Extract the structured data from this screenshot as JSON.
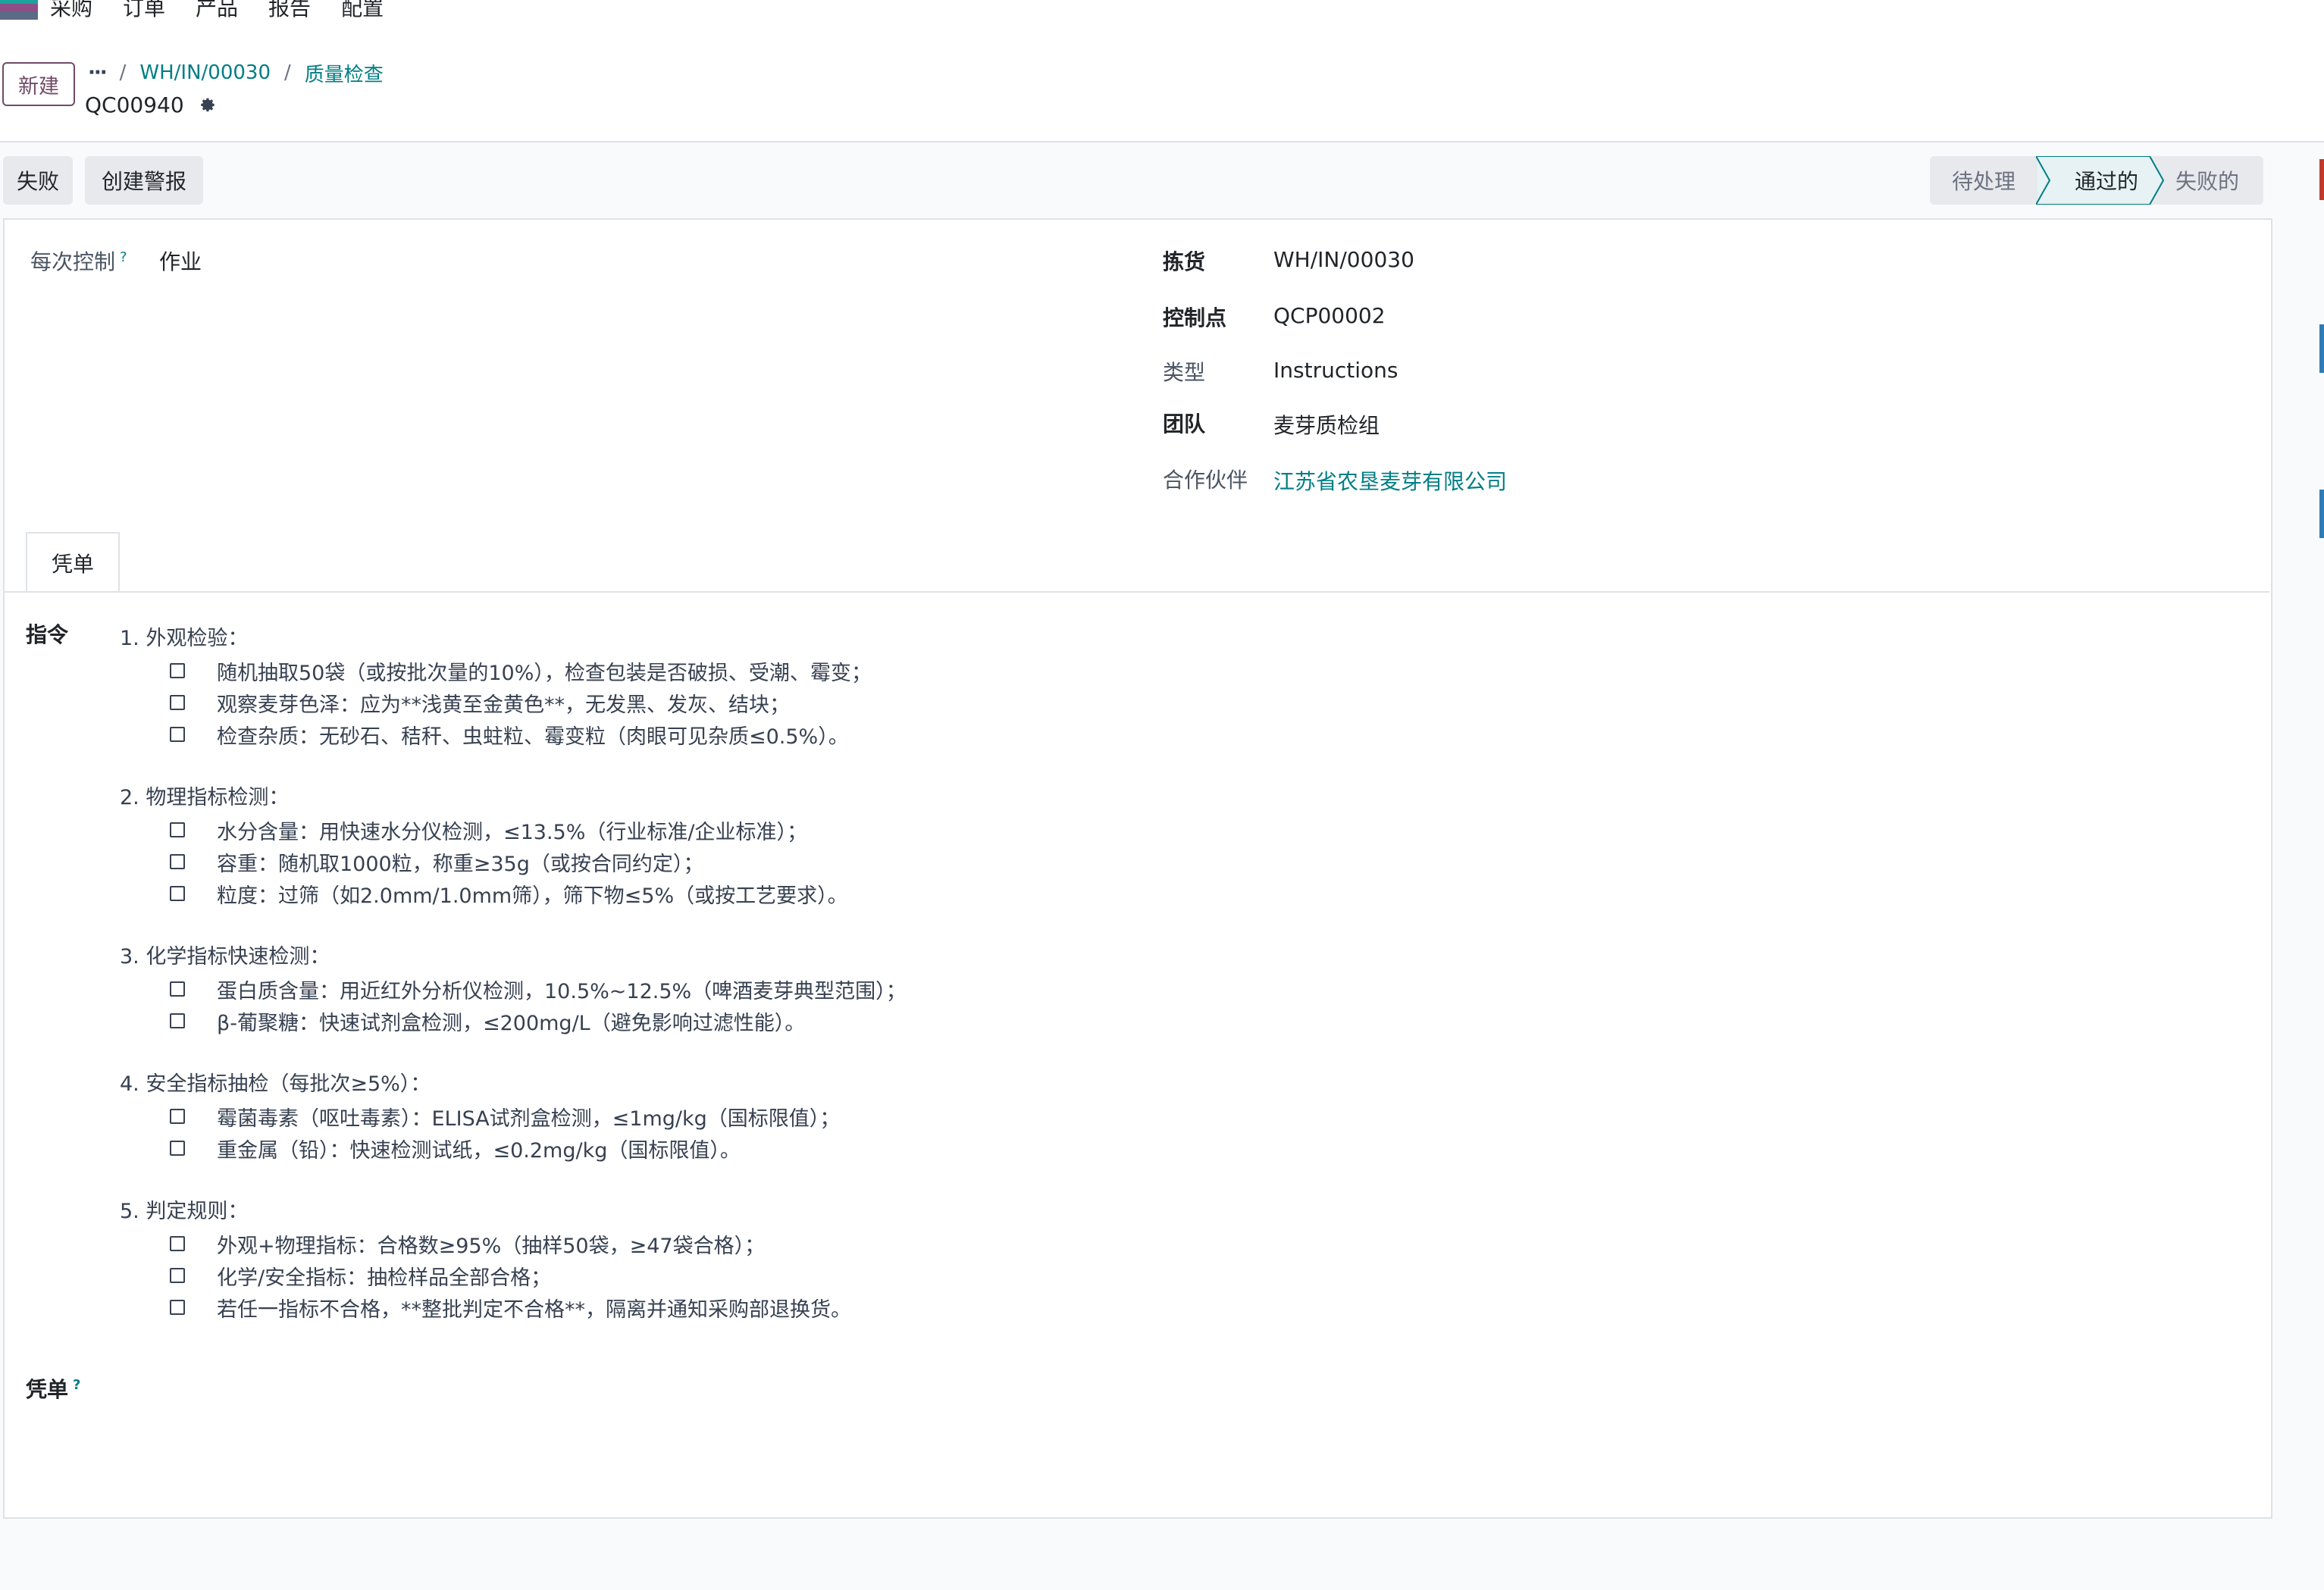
{
  "topnav": {
    "app_name": "采购",
    "menu": [
      "订单",
      "产品",
      "报告",
      "配置"
    ]
  },
  "control_panel": {
    "new_button": "新建",
    "breadcrumb": {
      "dots": "···",
      "sep": "/",
      "items": [
        "WH/IN/00030",
        "质量检查"
      ]
    },
    "record_name": "QC00940"
  },
  "actions": {
    "fail_button": "失败",
    "create_alert_button": "创建警报"
  },
  "statusbar": {
    "steps": [
      "待处理",
      "通过的",
      "失败的"
    ],
    "current": "通过的"
  },
  "form": {
    "left": {
      "control_per_label": "每次控制",
      "help": "?",
      "control_per_value": "作业"
    },
    "right": [
      {
        "label": "拣货",
        "value": "WH/IN/00030",
        "bold": true,
        "link": false
      },
      {
        "label": "控制点",
        "value": "QCP00002",
        "bold": true,
        "link": false
      },
      {
        "label": "类型",
        "value": "Instructions",
        "bold": false,
        "link": false
      },
      {
        "label": "团队",
        "value": "麦芽质检组",
        "bold": true,
        "link": false
      },
      {
        "label": "合作伙伴",
        "value": "江苏省农垦麦芽有限公司",
        "bold": false,
        "link": true
      }
    ],
    "tab_label": "凭单",
    "instructions_label": "指令",
    "sections": [
      {
        "title": "1. 外观检验：",
        "items": [
          "随机抽取50袋（或按批次量的10%），检查包装是否破损、受潮、霉变；",
          "观察麦芽色泽：应为**浅黄至金黄色**，无发黑、发灰、结块；",
          "检查杂质：无砂石、秸秆、虫蛀粒、霉变粒（肉眼可见杂质≤0.5%）。"
        ]
      },
      {
        "title": "2. 物理指标检测：",
        "items": [
          "水分含量：用快速水分仪检测，≤13.5%（行业标准/企业标准）；",
          "容重：随机取1000粒，称重≥35g（或按合同约定）；",
          "粒度：过筛（如2.0mm/1.0mm筛），筛下物≤5%（或按工艺要求）。"
        ]
      },
      {
        "title": "3. 化学指标快速检测：",
        "items": [
          "蛋白质含量：用近红外分析仪检测，10.5%~12.5%（啤酒麦芽典型范围）；",
          "β-葡聚糖：快速试剂盒检测，≤200mg/L（避免影响过滤性能）。"
        ]
      },
      {
        "title": "4. 安全指标抽检（每批次≥5%）：",
        "items": [
          "霉菌毒素（呕吐毒素）：ELISA试剂盒检测，≤1mg/kg（国标限值）；",
          "重金属（铅）：快速检测试纸，≤0.2mg/kg（国标限值）。"
        ]
      },
      {
        "title": "5. 判定规则：",
        "items": [
          "外观+物理指标：合格数≥95%（抽样50袋，≥47袋合格）；",
          "化学/安全指标：抽检样品全部合格；",
          "若任一指标不合格，**整批判定不合格**，隔离并通知采购部退换货。"
        ]
      }
    ],
    "voucher_label": "凭单",
    "voucher_help": "?"
  },
  "colors": {
    "brand": "#714b67",
    "link": "#017e84",
    "status_current_bg": "#e6f2f3"
  }
}
